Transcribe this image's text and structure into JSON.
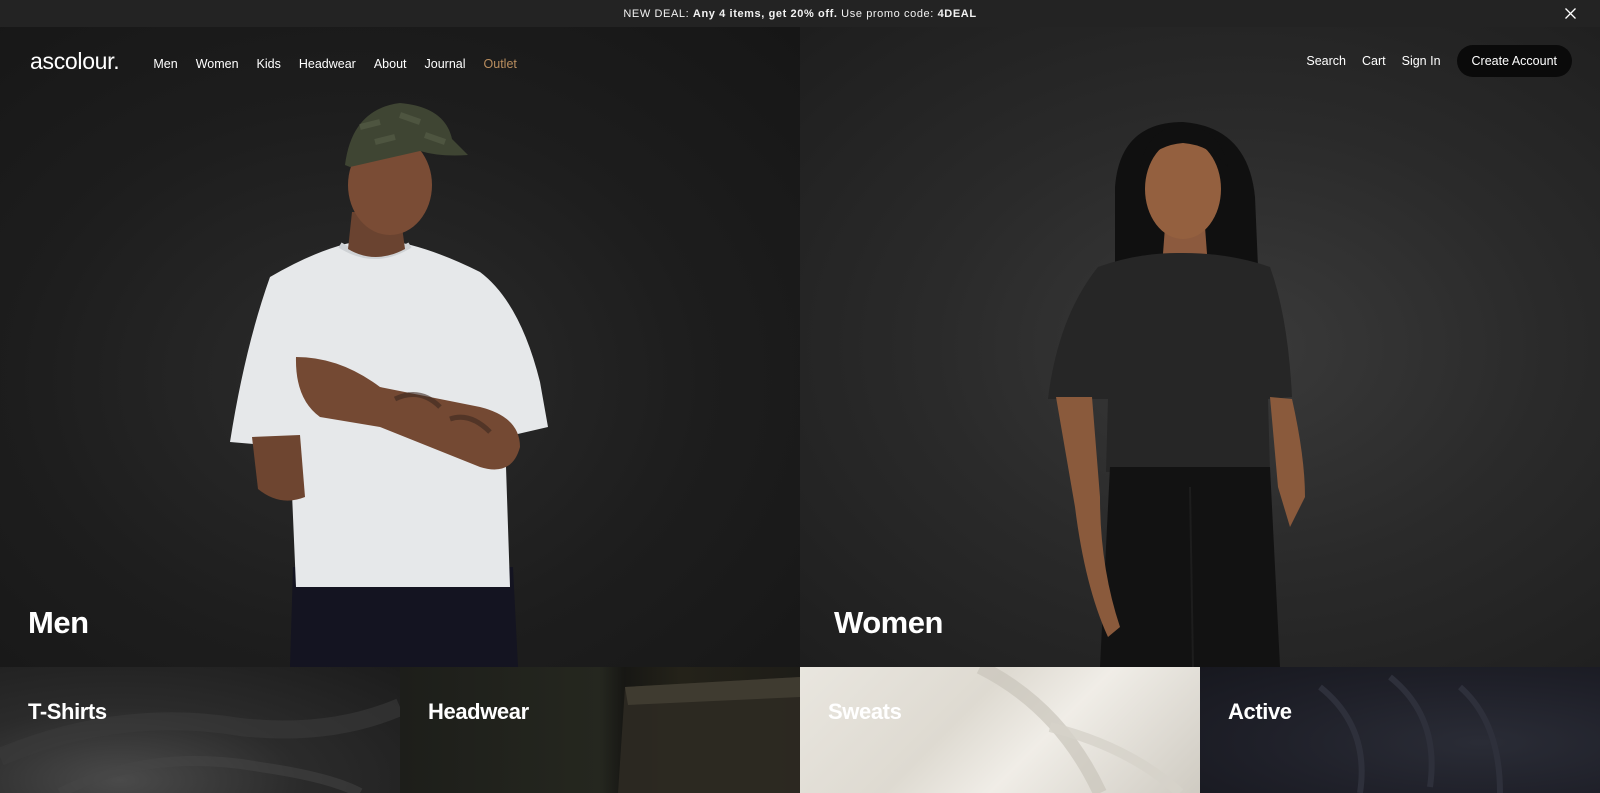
{
  "promo": {
    "prefix": "NEW DEAL:",
    "deal": "Any 4 items, get 20% off.",
    "middle": "Use promo code:",
    "code": "4DEAL",
    "close_icon": "close-icon"
  },
  "header": {
    "logo": "ascolour.",
    "nav": [
      "Men",
      "Women",
      "Kids",
      "Headwear",
      "About",
      "Journal",
      "Outlet"
    ],
    "outlet_color": "#b98d5e",
    "right": {
      "search": "Search",
      "cart": "Cart",
      "sign_in": "Sign In",
      "create_account": "Create Account"
    }
  },
  "hero": {
    "men_title": "Men",
    "women_title": "Women"
  },
  "categories": [
    "T-Shirts",
    "Headwear",
    "Sweats",
    "Active"
  ]
}
